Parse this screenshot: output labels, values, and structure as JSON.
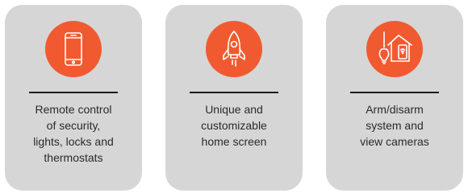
{
  "colors": {
    "card_background": "#d6d6d6",
    "icon_accent": "#f15a30",
    "divider": "#1c1c1c",
    "text": "#2a2a2a"
  },
  "features": [
    {
      "icon": "smartphone-icon",
      "text": "Remote control\nof security,\nlights, locks and\nthermostats"
    },
    {
      "icon": "rocket-icon",
      "text": "Unique and\ncustomizable\nhome screen"
    },
    {
      "icon": "smart-home-icon",
      "text": "Arm/disarm\nsystem and\nview cameras"
    }
  ]
}
